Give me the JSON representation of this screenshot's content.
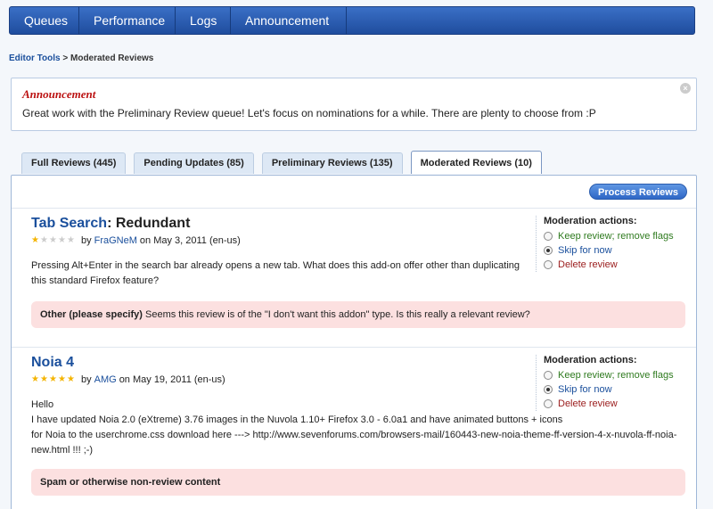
{
  "nav": {
    "items": [
      "Queues",
      "Performance",
      "Logs",
      "Announcement"
    ]
  },
  "breadcrumb": {
    "parent": "Editor Tools",
    "separator": ">",
    "current": "Moderated Reviews"
  },
  "announcement": {
    "title": "Announcement",
    "text": "Great work with the Preliminary Review queue! Let's focus on nominations for a while. There are plenty to choose from :P",
    "close": "×"
  },
  "tabs": [
    {
      "label": "Full Reviews (445)",
      "active": false
    },
    {
      "label": "Pending Updates (85)",
      "active": false
    },
    {
      "label": "Preliminary Reviews (135)",
      "active": false
    },
    {
      "label": "Moderated Reviews (10)",
      "active": true
    }
  ],
  "process_button": "Process Reviews",
  "reviews": [
    {
      "addon": "Tab Search",
      "title_suffix": ": Redundant",
      "rating": 1,
      "by": "by",
      "author": "FraGNeM",
      "date": "on May 3, 2011 (en-us)",
      "body": "Pressing Alt+Enter in the search bar already opens a new tab. What does this add-on offer other than duplicating this standard Firefox feature?",
      "flag_reason": "Other (please specify)",
      "flag_text": "Seems this review is of the \"I don't want this addon\" type. Is this really a relevant review?"
    },
    {
      "addon": "Noia 4",
      "title_suffix": "",
      "rating": 5,
      "by": "by",
      "author": "AMG",
      "date": "on May 19, 2011 (en-us)",
      "body_lines": [
        "Hello",
        "I have updated Noia 2.0 (eXtreme) 3.76 images in the Nuvola 1.10+ Firefox 3.0 - 6.0a1 and have animated buttons + icons",
        "for Noia to the userchrome.css download here ---> http://www.sevenforums.com/browsers-mail/160443-new-noia-theme-ff-version-4-x-nuvola-ff-noia-",
        "new.html !!! ;-)"
      ],
      "flag_reason": "Spam or otherwise non-review content",
      "flag_text": ""
    }
  ],
  "moderation": {
    "title": "Moderation actions:",
    "keep": "Keep review; remove flags",
    "skip": "Skip for now",
    "delete": "Delete review",
    "selected": "skip"
  },
  "colors": {
    "nav": "#1f4d9e",
    "link": "#1a4f9c",
    "flag_bg": "#fce0e0"
  }
}
